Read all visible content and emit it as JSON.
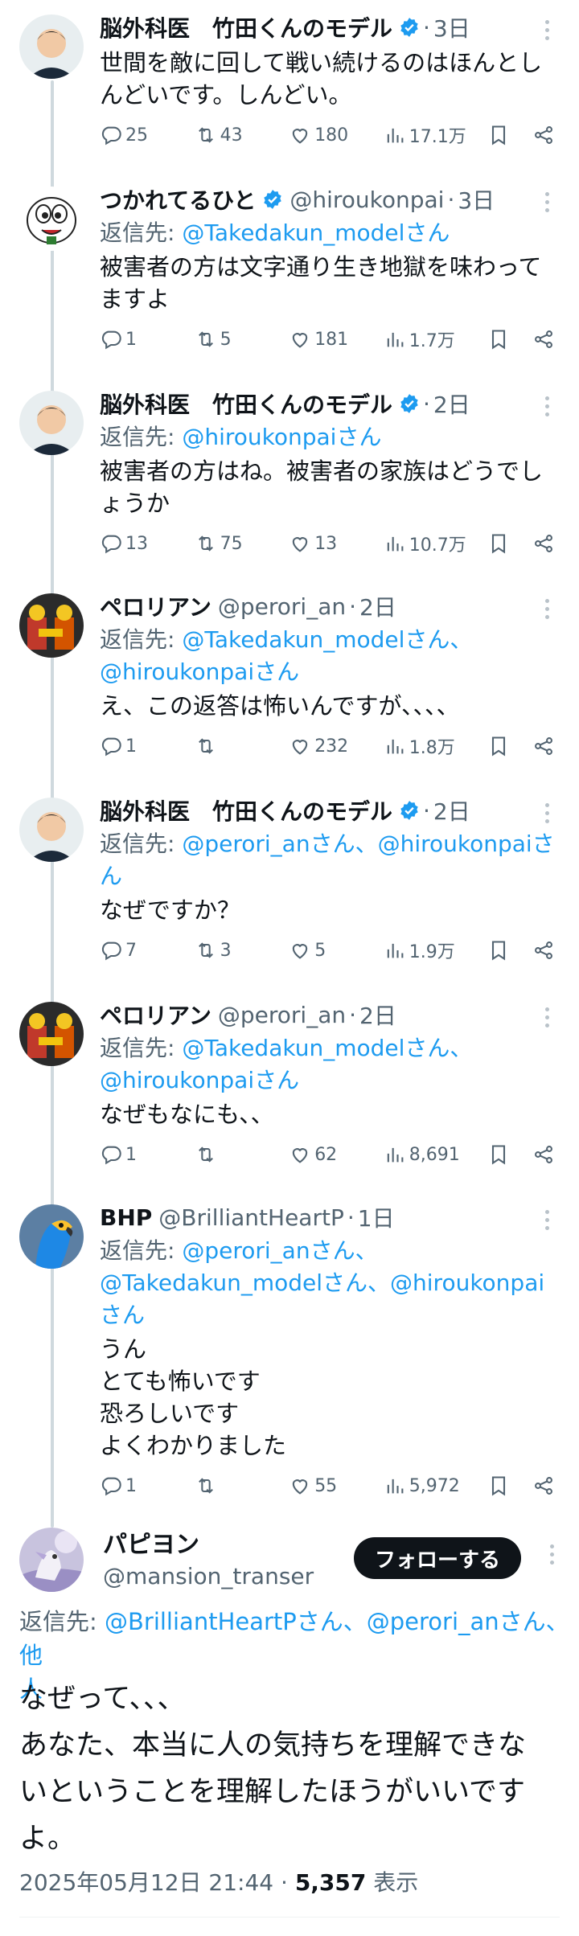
{
  "tweets": [
    {
      "name": "脳外科医　竹田くんのモデル",
      "verified": true,
      "handle": "",
      "time": "3日",
      "reply_to": [],
      "text": "世間を敵に回して戦い続けるのはほんとし\nんどいです。しんどい。",
      "replies": "25",
      "retweets": "43",
      "likes": "180",
      "views": "17.1万"
    },
    {
      "name": "つかれてるひと",
      "verified": true,
      "handle": "@hiroukonpai",
      "time": "3日",
      "reply_to_label": "返信先: ",
      "reply_to_text": "@Takedakun_modelさん",
      "text": "被害者の方は文字通り生き地獄を味わって\nますよ",
      "replies": "1",
      "retweets": "5",
      "likes": "181",
      "views": "1.7万"
    },
    {
      "name": "脳外科医　竹田くんのモデル",
      "verified": true,
      "handle": "",
      "time": "2日",
      "reply_to_label": "返信先: ",
      "reply_to_text": "@hiroukonpaiさん",
      "text": "被害者の方はね。被害者の家族はどうでし\nょうか",
      "replies": "13",
      "retweets": "75",
      "likes": "13",
      "views": "10.7万"
    },
    {
      "name": "ペロリアン",
      "verified": false,
      "handle": "@perori_an",
      "time": "2日",
      "reply_to_label": "返信先: ",
      "reply_to_text": "@Takedakun_modelさん、\n@hiroukonpaiさん",
      "text": "え、この返答は怖いんですが、、、、",
      "replies": "1",
      "retweets": "",
      "likes": "232",
      "views": "1.8万"
    },
    {
      "name": "脳外科医　竹田くんのモデル",
      "verified": true,
      "handle": "",
      "time": "2日",
      "reply_to_label": "返信先: ",
      "reply_to_text": "@perori_anさん、@hiroukonpaiさ\nん",
      "text": "なぜですか？",
      "replies": "7",
      "retweets": "3",
      "likes": "5",
      "views": "1.9万"
    },
    {
      "name": "ペロリアン",
      "verified": false,
      "handle": "@perori_an",
      "time": "2日",
      "reply_to_label": "返信先: ",
      "reply_to_text": "@Takedakun_modelさん、\n@hiroukonpaiさん",
      "text": "なぜもなにも、、",
      "replies": "1",
      "retweets": "",
      "likes": "62",
      "views": "8,691"
    },
    {
      "name": "BHP",
      "verified": false,
      "handle": "@BrilliantHeartP",
      "time": "1日",
      "reply_to_label": "返信先: ",
      "reply_to_text": "@perori_anさん、\n@Takedakun_modelさん、@hiroukonpai\nさん",
      "text": "うん\nとても怖いです\n恐ろしいです\nよくわかりました",
      "replies": "1",
      "retweets": "",
      "likes": "55",
      "views": "5,972"
    }
  ],
  "main": {
    "name": "パピヨン",
    "handle": "@mansion_transer",
    "follow_label": "フォローする",
    "reply_to_label": "返信先: ",
    "reply_to_text": "@BrilliantHeartPさん、@perori_anさん、他\n人",
    "text": "なぜって、、、\nあなた、本当に人の気持ちを理解できな\nいということを理解したほうがいいです\nよ。",
    "date": "2025年05月12日 21:44",
    "views_count": "5,357",
    "views_label": "表示"
  },
  "colors": {
    "accent": "#1d9bf0",
    "text": "#0f1419",
    "muted": "#536471",
    "line": "#cfd9de"
  }
}
